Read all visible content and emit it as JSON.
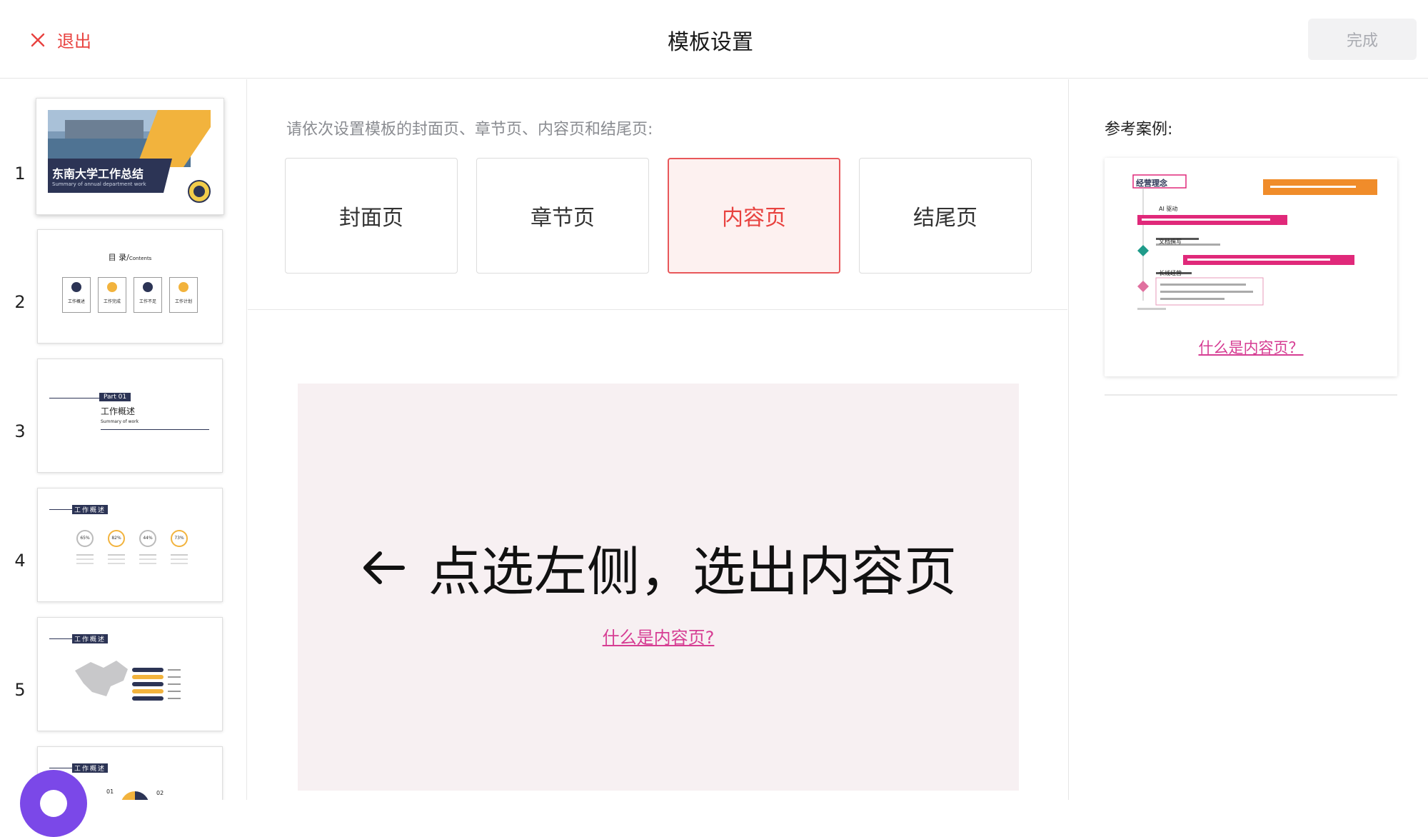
{
  "header": {
    "exit_label": "退出",
    "title": "模板设置",
    "done_label": "完成"
  },
  "slides": [
    {
      "number": "1",
      "title": "东南大学工作总结",
      "subtitle": "Summary of annual department work"
    },
    {
      "number": "2",
      "title": "目 录/",
      "title_suffix": "Contents",
      "items": [
        "工作概述",
        "工作完成",
        "工作不足",
        "工作计划"
      ]
    },
    {
      "number": "3",
      "part": "Part  01",
      "title": "工作概述",
      "subtitle": "Summary of work"
    },
    {
      "number": "4",
      "heading": "工作概述",
      "stats": [
        "65%",
        "82%",
        "44%",
        "73%"
      ]
    },
    {
      "number": "5",
      "heading": "工作概述"
    },
    {
      "number": "6",
      "heading": "工作概述",
      "items": [
        "01",
        "02"
      ]
    }
  ],
  "main": {
    "instruction": "请依次设置模板的封面页、章节页、内容页和结尾页:",
    "page_types": [
      {
        "label": "封面页",
        "selected": false
      },
      {
        "label": "章节页",
        "selected": false
      },
      {
        "label": "内容页",
        "selected": true
      },
      {
        "label": "结尾页",
        "selected": false
      }
    ],
    "hint": "点选左侧，选出内容页",
    "help_link": "什么是内容页?"
  },
  "reference": {
    "label": "参考案例:",
    "link": "什么是内容页？",
    "sample": {
      "heading": "经营理念",
      "items": [
        "AI 驱动",
        "文档撰写",
        "长线经营"
      ]
    }
  },
  "colors": {
    "accent": "#e8423f",
    "link": "#d63d93",
    "navy": "#2c3455",
    "gold": "#f2b33d",
    "preview_bg": "#f7f0f2",
    "fab": "#7b48e8"
  }
}
